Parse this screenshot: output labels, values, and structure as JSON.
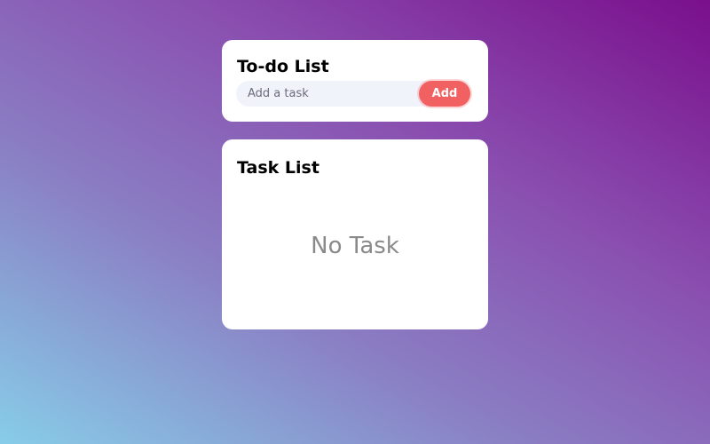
{
  "todo": {
    "title": "To-do List",
    "input_placeholder": "Add a task",
    "input_value": "",
    "add_label": "Add"
  },
  "tasks": {
    "title": "Task List",
    "empty_message": "No Task",
    "items": []
  },
  "colors": {
    "accent": "#f26161",
    "card_bg": "#ffffff",
    "input_bg": "#f1f3fb",
    "gradient_start": "#87cde8",
    "gradient_end": "#7a0f8c"
  }
}
